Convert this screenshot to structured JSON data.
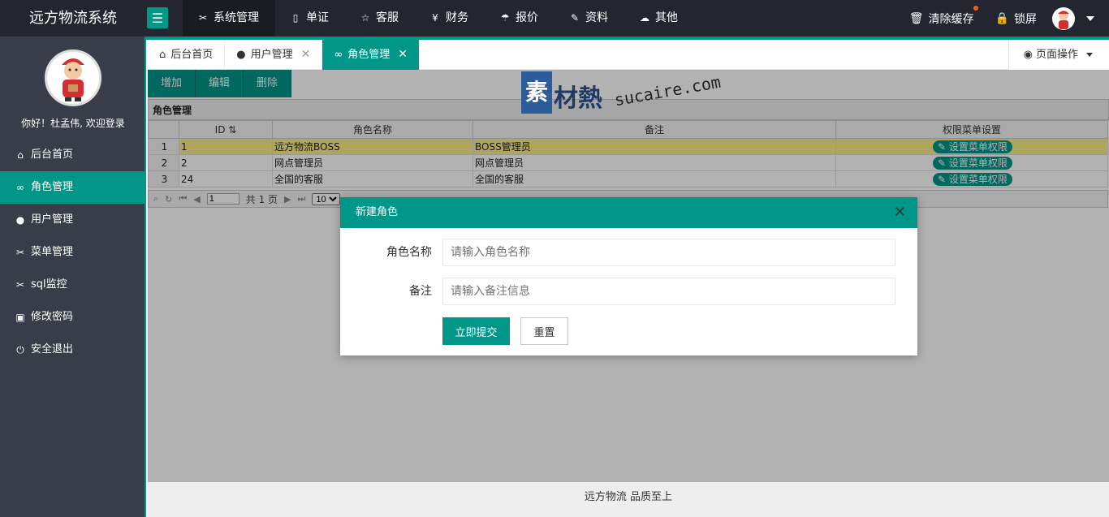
{
  "app": {
    "title": "远方物流系统"
  },
  "topnav": [
    {
      "label": "系统管理",
      "icon": "tools-icon",
      "active": true
    },
    {
      "label": "单证",
      "icon": "book-icon"
    },
    {
      "label": "客服",
      "icon": "star-icon"
    },
    {
      "label": "财务",
      "icon": "yen-icon"
    },
    {
      "label": "报价",
      "icon": "umbrella-icon"
    },
    {
      "label": "资料",
      "icon": "edit-icon"
    },
    {
      "label": "其他",
      "icon": "cloud-upload-icon"
    }
  ],
  "header_right": {
    "clear_cache": "清除缓存",
    "lock": "锁屏"
  },
  "sidebar": {
    "welcome": "你好！杜孟伟, 欢迎登录",
    "items": [
      {
        "label": "后台首页",
        "icon": "home-icon"
      },
      {
        "label": "角色管理",
        "icon": "users-icon",
        "active": true
      },
      {
        "label": "用户管理",
        "icon": "user-icon"
      },
      {
        "label": "菜单管理",
        "icon": "tools-icon"
      },
      {
        "label": "sql监控",
        "icon": "tools-icon"
      },
      {
        "label": "修改密码",
        "icon": "image-icon"
      },
      {
        "label": "安全退出",
        "icon": "power-icon"
      }
    ]
  },
  "tabs": [
    {
      "label": "后台首页",
      "icon": "home-icon"
    },
    {
      "label": "用户管理",
      "icon": "user-icon",
      "closable": true
    },
    {
      "label": "角色管理",
      "icon": "users-icon",
      "closable": true,
      "active": true
    }
  ],
  "page_ops": "页面操作",
  "toolbar": {
    "add": "增加",
    "edit": "编辑",
    "delete": "删除"
  },
  "grid": {
    "title": "角色管理",
    "columns": {
      "id": "ID",
      "name": "角色名称",
      "remark": "备注",
      "perm": "权限菜单设置"
    },
    "rows": [
      {
        "rn": "1",
        "id": "1",
        "name": "远方物流BOSS",
        "remark": "BOSS管理员",
        "perm": "设置菜单权限"
      },
      {
        "rn": "2",
        "id": "2",
        "name": "网点管理员",
        "remark": "网点管理员",
        "perm": "设置菜单权限"
      },
      {
        "rn": "3",
        "id": "24",
        "name": "全国的客服",
        "remark": "全国的客服",
        "perm": "设置菜单权限"
      }
    ],
    "pager": {
      "page": "1",
      "total_pages": "共 1 页",
      "page_size": "10"
    }
  },
  "watermark": {
    "box": "素",
    "text": "材熱",
    "url": "sucaire.com"
  },
  "modal": {
    "title": "新建角色",
    "name_label": "角色名称",
    "name_placeholder": "请输入角色名称",
    "remark_label": "备注",
    "remark_placeholder": "请输入备注信息",
    "submit": "立即提交",
    "reset": "重置"
  },
  "footer": "远方物流 品质至上"
}
